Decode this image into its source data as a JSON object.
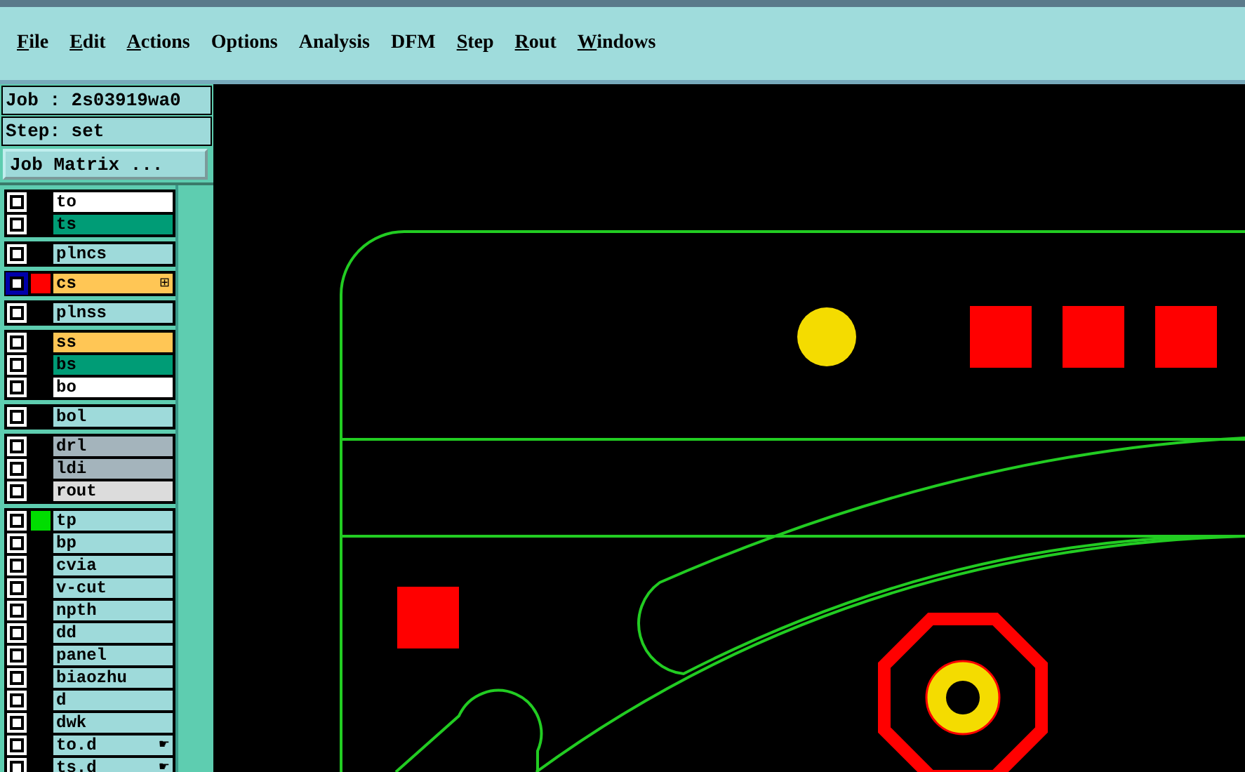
{
  "menu": [
    {
      "label": "File",
      "underlined": true
    },
    {
      "label": "Edit",
      "underlined": true
    },
    {
      "label": "Actions",
      "underlined": true
    },
    {
      "label": "Options",
      "underlined": false
    },
    {
      "label": "Analysis",
      "underlined": false
    },
    {
      "label": "DFM",
      "underlined": false
    },
    {
      "label": "Step",
      "underlined": true
    },
    {
      "label": "Rout",
      "underlined": true
    },
    {
      "label": "Windows",
      "underlined": true
    }
  ],
  "job": "Job : 2s03919wa0",
  "step": "Step: set",
  "job_matrix_button": "Job Matrix ...",
  "layer_groups": [
    [
      {
        "name": "to",
        "color": "#ffffff",
        "selected": false,
        "shown": false
      },
      {
        "name": "ts",
        "color": "#009c76",
        "selected": false,
        "shown": false
      }
    ],
    [
      {
        "name": "plncs",
        "color": "#9edada",
        "selected": false,
        "shown": false
      }
    ],
    [
      {
        "name": "cs",
        "color": "#ffc655",
        "selected": true,
        "shown": true,
        "mark": "⊞"
      }
    ],
    [
      {
        "name": "plnss",
        "color": "#9edada",
        "selected": false,
        "shown": false
      }
    ],
    [
      {
        "name": "ss",
        "color": "#ffc655",
        "selected": false,
        "shown": false
      },
      {
        "name": "bs",
        "color": "#009c76",
        "selected": false,
        "shown": false
      },
      {
        "name": "bo",
        "color": "#ffffff",
        "selected": false,
        "shown": false
      }
    ],
    [
      {
        "name": "bol",
        "color": "#9edada",
        "selected": false,
        "shown": false
      }
    ],
    [
      {
        "name": "drl",
        "color": "#a4b4bc",
        "selected": false,
        "shown": false
      },
      {
        "name": "ldi",
        "color": "#a4b4bc",
        "selected": false,
        "shown": false
      },
      {
        "name": "rout",
        "color": "#dcdcdc",
        "selected": false,
        "shown": false
      }
    ],
    [
      {
        "name": "tp",
        "color": "#9edada",
        "selected": false,
        "shown": true
      },
      {
        "name": "bp",
        "color": "#9edada",
        "selected": false,
        "shown": false
      },
      {
        "name": "cvia",
        "color": "#9edada",
        "selected": false,
        "shown": false
      },
      {
        "name": "v-cut",
        "color": "#9edada",
        "selected": false,
        "shown": false
      },
      {
        "name": "npth",
        "color": "#9edada",
        "selected": false,
        "shown": false
      },
      {
        "name": "dd",
        "color": "#9edada",
        "selected": false,
        "shown": false
      },
      {
        "name": "panel",
        "color": "#9edada",
        "selected": false,
        "shown": false
      },
      {
        "name": "biaozhu",
        "color": "#9edada",
        "selected": false,
        "shown": false
      },
      {
        "name": "d",
        "color": "#9edada",
        "selected": false,
        "shown": false
      },
      {
        "name": "dwk",
        "color": "#9edada",
        "selected": false,
        "shown": false
      },
      {
        "name": "to.d",
        "color": "#9edada",
        "selected": false,
        "shown": false,
        "mark": "☛"
      },
      {
        "name": "ts.d",
        "color": "#9edada",
        "selected": false,
        "shown": false,
        "mark": "☛"
      }
    ]
  ]
}
